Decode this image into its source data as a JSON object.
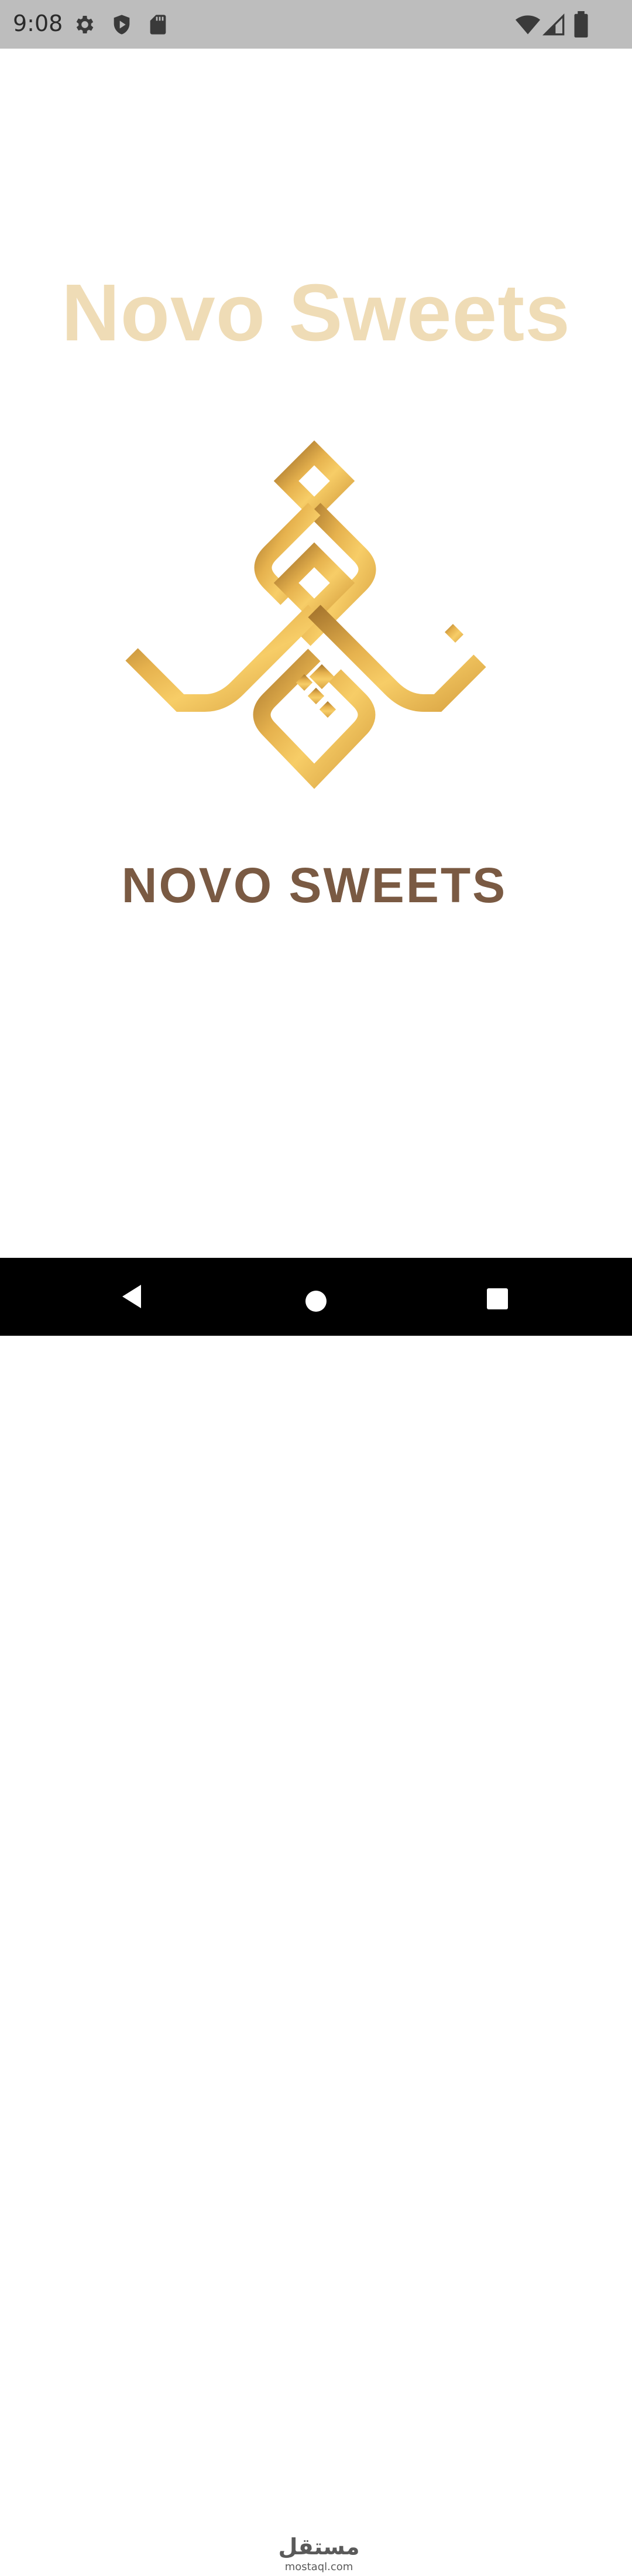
{
  "status_bar": {
    "time": "9:08",
    "left_icons": [
      "gear-icon",
      "shield-play-icon",
      "sd-card-icon"
    ],
    "right_icons": [
      "wifi-icon",
      "cellular-signal-icon",
      "battery-icon"
    ]
  },
  "splash": {
    "title": "Novo Sweets",
    "logo_wordmark": "NOVO SWEETS",
    "colors": {
      "title": "#efdcb6",
      "logo_gold": "#e2b04a",
      "wordmark_brown": "#7a5a43"
    }
  },
  "nav_bar": {
    "buttons": [
      "back-icon",
      "home-icon",
      "recents-icon"
    ],
    "watermark_text": "mostaql.com"
  }
}
